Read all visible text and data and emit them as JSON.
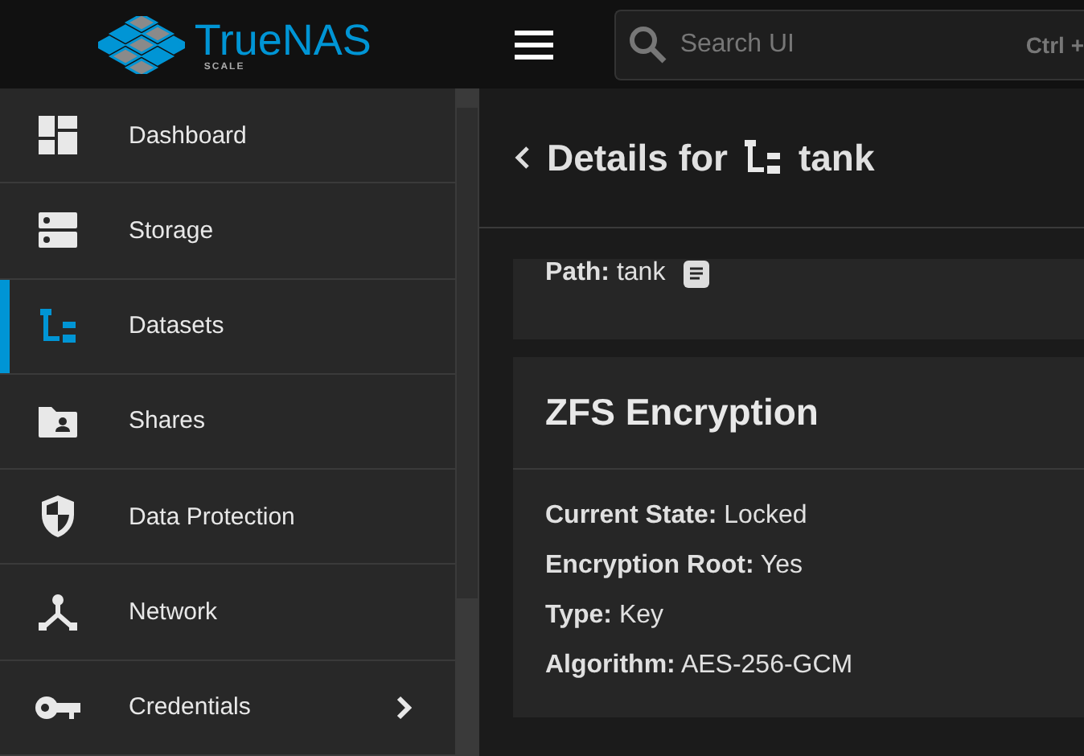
{
  "logo": {
    "name": "TrueNAS",
    "edition": "SCALE"
  },
  "search": {
    "placeholder": "Search UI",
    "shortcut": "Ctrl +"
  },
  "sidebar": {
    "items": [
      {
        "label": "Dashboard",
        "kind": "dashboard",
        "selected": false
      },
      {
        "label": "Storage",
        "kind": "storage",
        "selected": false
      },
      {
        "label": "Datasets",
        "kind": "datasets",
        "selected": true
      },
      {
        "label": "Shares",
        "kind": "shares",
        "selected": false
      },
      {
        "label": "Data Protection",
        "kind": "shield",
        "selected": false
      },
      {
        "label": "Network",
        "kind": "network",
        "selected": false
      },
      {
        "label": "Credentials",
        "kind": "key",
        "selected": false,
        "expandable": true
      }
    ]
  },
  "page": {
    "title": "Details for",
    "dataset": "tank"
  },
  "path_card": {
    "label": "Path:",
    "value": "tank"
  },
  "encryption_card": {
    "title": "ZFS Encryption",
    "fields": [
      {
        "label": "Current State:",
        "value": "Locked"
      },
      {
        "label": "Encryption Root:",
        "value": "Yes"
      },
      {
        "label": "Type:",
        "value": "Key"
      },
      {
        "label": "Algorithm:",
        "value": "AES-256-GCM"
      }
    ]
  }
}
